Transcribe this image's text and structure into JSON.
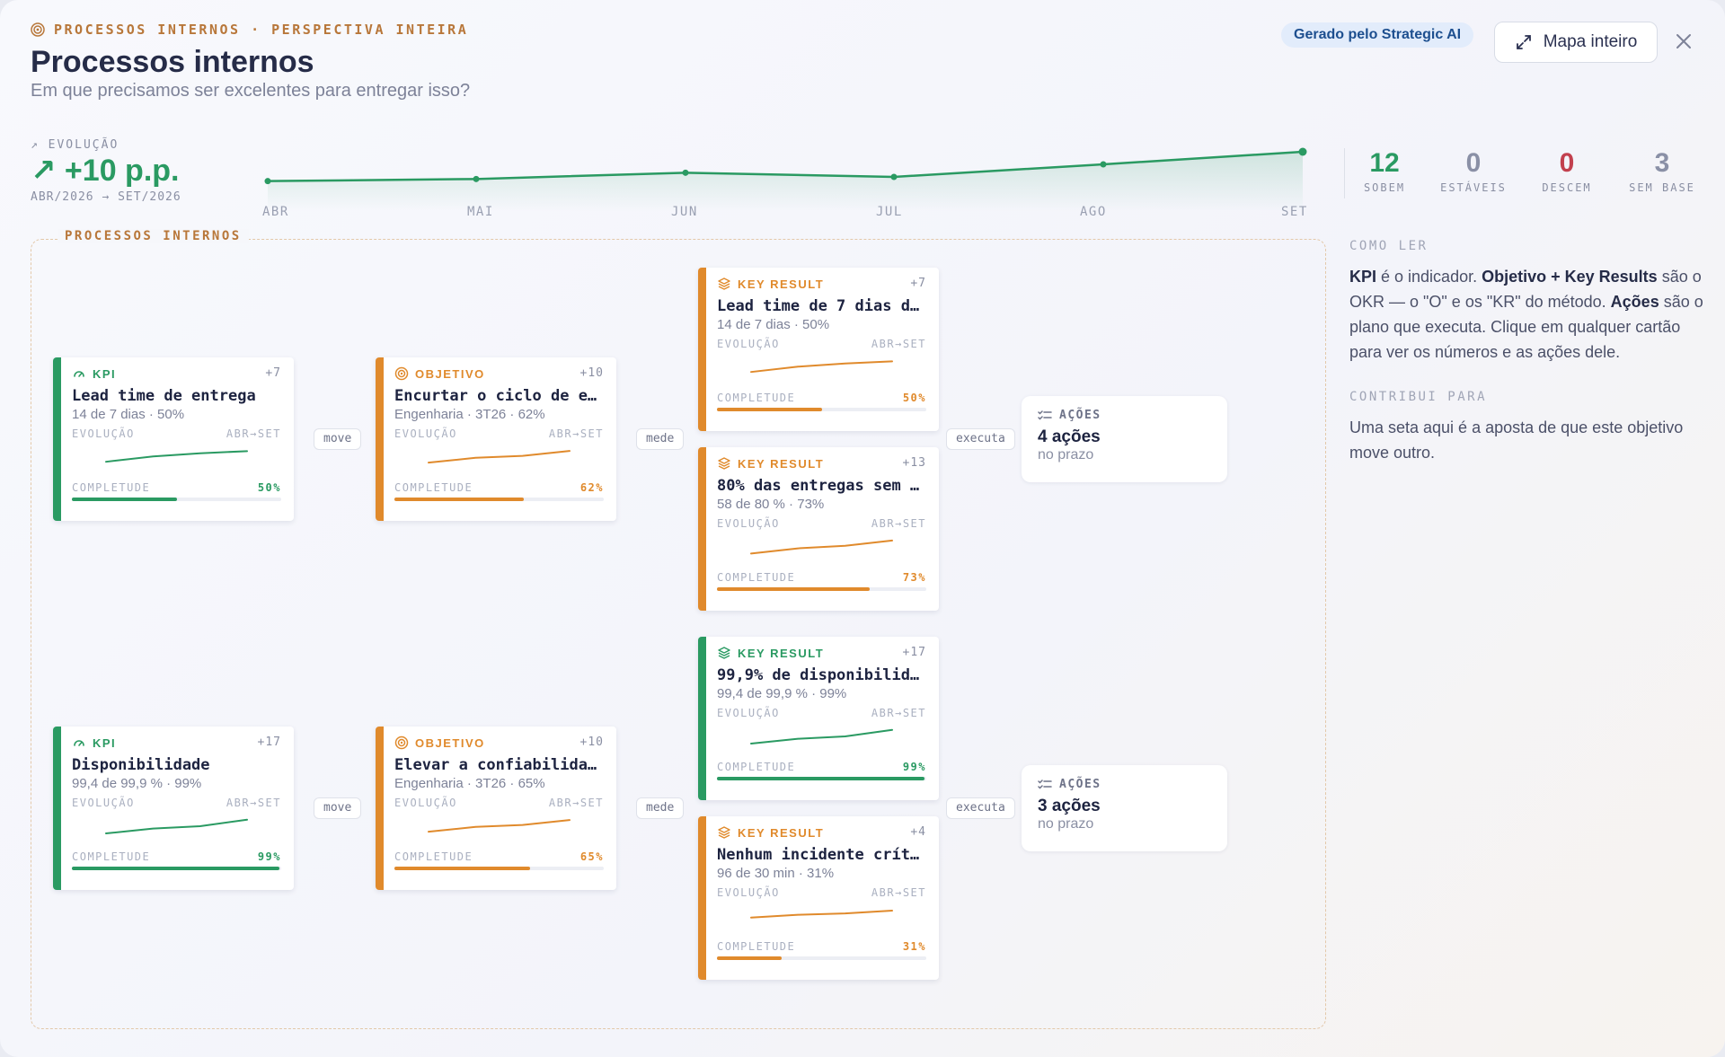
{
  "header": {
    "eyebrow": "PROCESSOS INTERNOS · PERSPECTIVA INTEIRA",
    "title": "Processos internos",
    "subtitle": "Em que precisamos ser excelentes para entregar isso?",
    "ai_badge": "Gerado pelo Strategic AI",
    "map_button": "Mapa inteiro"
  },
  "evolution": {
    "label": "↗ EVOLUÇÃO",
    "value": "↗ +10 p.p.",
    "range": "ABR/2026 → SET/2026",
    "months": [
      "ABR",
      "MAI",
      "JUN",
      "JUL",
      "AGO",
      "SET"
    ],
    "trend_values": [
      50,
      51,
      54,
      52,
      58,
      64
    ],
    "color": "#2a9a62"
  },
  "stats": [
    {
      "value": "12",
      "label": "SOBEM",
      "color": "#2a9a62"
    },
    {
      "value": "0",
      "label": "ESTÁVEIS",
      "color": "#8a90a6"
    },
    {
      "value": "0",
      "label": "DESCEM",
      "color": "#c2404e"
    },
    {
      "value": "3",
      "label": "SEM BASE",
      "color": "#8a90a6"
    }
  ],
  "how_to_read": {
    "heading": "COMO LER",
    "kpi": "KPI",
    "t1": " é o indicador. ",
    "okr": "Objetivo + Key Results",
    "t2": " são o OKR — o \"O\" e os \"KR\" do método. ",
    "acoes": "Ações",
    "t3": " são o plano que executa. Clique em qualquer cartão para ver os números e as ações dele."
  },
  "contributes": {
    "heading": "CONTRIBUI PARA",
    "text": "Uma seta aqui é a aposta de que este objetivo move outro."
  },
  "group_label": "PROCESSOS INTERNOS",
  "colors": {
    "green": "#2a9a62",
    "orange": "#e08a2c"
  },
  "card_labels": {
    "evolution": "EVOLUÇÃO",
    "range": "ABR→SET",
    "completeness": "COMPLETUDE"
  },
  "cards": {
    "kpi1": {
      "type": "KPI",
      "delta": "+7",
      "title": "Lead time de entrega",
      "sub": "14 de 7 dias · 50%",
      "pct": "50%",
      "progress": 0.5,
      "color": "green",
      "spark": [
        40,
        45,
        48,
        50
      ]
    },
    "obj1": {
      "type": "OBJETIVO",
      "delta": "+10",
      "title": "Encurtar o ciclo de e…",
      "sub": "Engenharia · 3T26 · 62%",
      "pct": "62%",
      "progress": 0.62,
      "color": "orange",
      "spark": [
        50,
        55,
        57,
        62
      ]
    },
    "kr1": {
      "type": "KEY RESULT",
      "delta": "+7",
      "title": "Lead time de 7 dias d…",
      "sub": "14 de 7 dias · 50%",
      "pct": "50%",
      "progress": 0.5,
      "color": "orange",
      "spark": [
        40,
        45,
        48,
        50
      ]
    },
    "kr2": {
      "type": "KEY RESULT",
      "delta": "+13",
      "title": "80% das entregas sem …",
      "sub": "58 de 80 % · 73%",
      "pct": "73%",
      "progress": 0.73,
      "color": "orange",
      "spark": [
        58,
        64,
        67,
        73
      ]
    },
    "kpi2": {
      "type": "KPI",
      "delta": "+17",
      "title": "Disponibilidade",
      "sub": "99,4 de 99,9 % · 99%",
      "pct": "99%",
      "progress": 0.99,
      "color": "green",
      "spark": [
        82,
        88,
        91,
        99
      ]
    },
    "obj2": {
      "type": "OBJETIVO",
      "delta": "+10",
      "title": "Elevar a confiabilida…",
      "sub": "Engenharia · 3T26 · 65%",
      "pct": "65%",
      "progress": 0.65,
      "color": "orange",
      "spark": [
        53,
        58,
        60,
        65
      ]
    },
    "kr3": {
      "type": "KEY RESULT",
      "delta": "+17",
      "title": "99,9% de disponibilid…",
      "sub": "99,4 de 99,9 % · 99%",
      "pct": "99%",
      "progress": 0.99,
      "color": "green",
      "spark": [
        82,
        88,
        91,
        99
      ]
    },
    "kr4": {
      "type": "KEY RESULT",
      "delta": "+4",
      "title": "Nenhum incidente crít…",
      "sub": "96 de 30 min · 31%",
      "pct": "31%",
      "progress": 0.31,
      "color": "orange",
      "spark": [
        26,
        28,
        29,
        31
      ]
    }
  },
  "connectors": {
    "move": "move",
    "mede": "mede",
    "executa": "executa"
  },
  "actions": [
    {
      "label": "AÇÕES",
      "count": "4 ações",
      "status": "no prazo"
    },
    {
      "label": "AÇÕES",
      "count": "3 ações",
      "status": "no prazo"
    }
  ]
}
